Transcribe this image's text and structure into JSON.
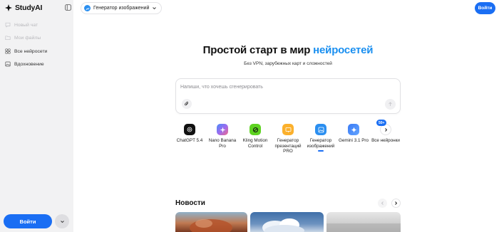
{
  "app": {
    "name": "StudyAI"
  },
  "sidebar": {
    "items": [
      {
        "label": "Новый чат",
        "icon": "chat-plus-icon",
        "state": "disabled"
      },
      {
        "label": "Мои файлы",
        "icon": "folder-icon",
        "state": "disabled"
      },
      {
        "label": "Все нейросети",
        "icon": "grid-icon",
        "state": "active"
      },
      {
        "label": "Вдохновение",
        "icon": "image-icon",
        "state": "active"
      }
    ],
    "login_label": "Войти"
  },
  "topbar": {
    "model_selector": {
      "label": "Генератор изображений",
      "icon": "image-generator-icon"
    },
    "login_label": "Войти"
  },
  "hero": {
    "title_main": "Простой старт в мир",
    "title_accent": "нейросетей",
    "subtitle": "Без VPN, зарубежных карт и сложностей"
  },
  "prompt": {
    "placeholder": "Напиши, что хочешь сгенерировать",
    "value": ""
  },
  "models": {
    "items": [
      {
        "label": "ChatGPT 5.4",
        "icon": "chatgpt-icon",
        "selected": false
      },
      {
        "label": "Nano Banana Pro",
        "icon": "nano-banana-icon",
        "selected": false
      },
      {
        "label": "Kling Motion Control",
        "icon": "kling-icon",
        "selected": false
      },
      {
        "label": "Генератор презентаций PRO",
        "icon": "presentation-icon",
        "selected": false
      },
      {
        "label": "Генератор изображений",
        "icon": "image-generator-icon",
        "selected": true
      },
      {
        "label": "Gemini 3.1 Pro",
        "icon": "gemini-icon",
        "selected": false
      },
      {
        "label": "Все нейронки",
        "icon": "chevron-right-icon",
        "selected": false
      }
    ],
    "all_count_badge": "50+"
  },
  "news": {
    "title": "Новости"
  },
  "colors": {
    "accent": "#1a6ef3",
    "title_accent": "#1a8ff0",
    "sidebar_bg": "#f2f2f3"
  }
}
